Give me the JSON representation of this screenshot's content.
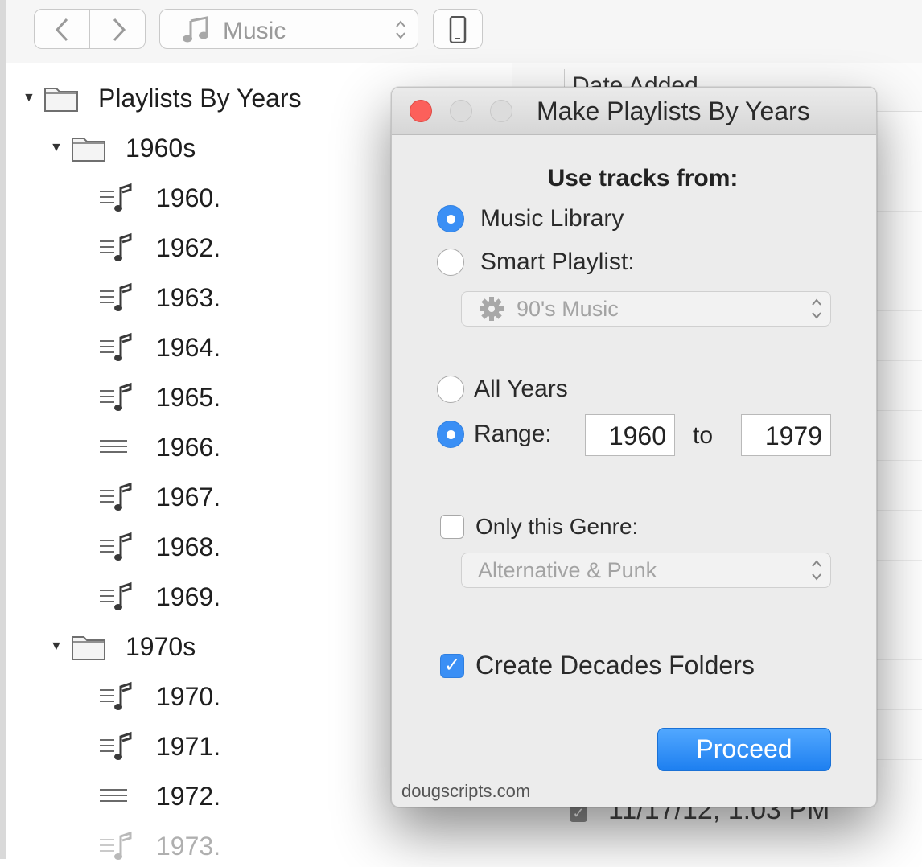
{
  "toolbar": {
    "media_kind": "Music"
  },
  "sidebar": {
    "root_folder": "Playlists By Years",
    "folders": [
      {
        "label": "1960s",
        "playlists": [
          {
            "label": "1960.",
            "icon": "playlist-music-icon"
          },
          {
            "label": "1962.",
            "icon": "playlist-music-icon"
          },
          {
            "label": "1963.",
            "icon": "playlist-music-icon"
          },
          {
            "label": "1964.",
            "icon": "playlist-music-icon"
          },
          {
            "label": "1965.",
            "icon": "playlist-music-icon"
          },
          {
            "label": "1966.",
            "icon": "playlist-plain-icon"
          },
          {
            "label": "1967.",
            "icon": "playlist-music-icon"
          },
          {
            "label": "1968.",
            "icon": "playlist-music-icon"
          },
          {
            "label": "1969.",
            "icon": "playlist-music-icon"
          }
        ]
      },
      {
        "label": "1970s",
        "playlists": [
          {
            "label": "1970.",
            "icon": "playlist-music-icon"
          },
          {
            "label": "1971.",
            "icon": "playlist-music-icon"
          },
          {
            "label": "1972.",
            "icon": "playlist-plain-icon"
          },
          {
            "label": "1973.",
            "icon": "playlist-music-icon"
          }
        ]
      }
    ]
  },
  "list": {
    "column_header": "Date Added",
    "visible_date": "11/17/12, 1:03 PM"
  },
  "dialog": {
    "title": "Make Playlists By Years",
    "section_heading": "Use tracks from:",
    "source_options": [
      {
        "label": "Music Library",
        "selected": true
      },
      {
        "label": "Smart Playlist:",
        "selected": false
      }
    ],
    "smart_playlist_value": "90's Music",
    "year_options": [
      {
        "label": "All Years",
        "selected": false
      },
      {
        "label": "Range:",
        "selected": true
      }
    ],
    "range_from": "1960",
    "range_to_label": "to",
    "range_to": "1979",
    "genre_checkbox": {
      "label": "Only this Genre:",
      "checked": false
    },
    "genre_value": "Alternative & Punk",
    "decades_checkbox": {
      "label": "Create Decades Folders",
      "checked": true
    },
    "proceed_label": "Proceed",
    "credit": "dougscripts.com"
  },
  "colors": {
    "accent": "#3a8ff5",
    "close_light": "#fc605b"
  }
}
